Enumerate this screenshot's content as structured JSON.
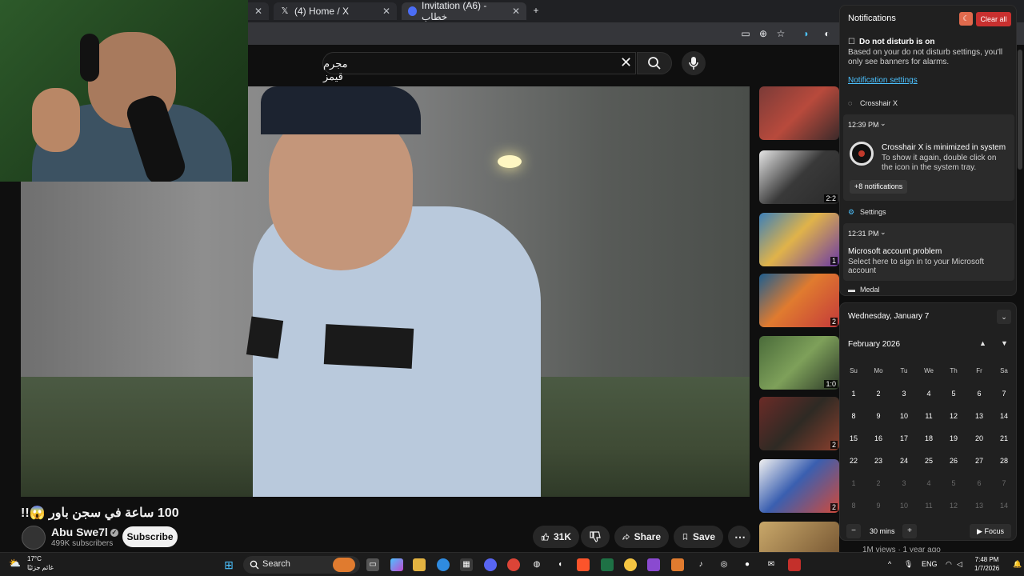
{
  "browser": {
    "tabs": [
      {
        "label": ""
      },
      {
        "label": "(4) Home / X"
      },
      {
        "label": "Invitation (A6) - خطاب"
      }
    ],
    "new_tab": "+"
  },
  "youtube": {
    "search": {
      "value": "مجرم قيمز"
    },
    "video_title": "100 ساعة في سجن باور 😱!!",
    "channel": {
      "name": "Abu Swe7l",
      "subscribers": "499K subscribers"
    },
    "subscribe_label": "Subscribe",
    "actions": {
      "like_count": "31K",
      "share_label": "Share",
      "save_label": "Save"
    },
    "sidebar": [
      {
        "duration": ""
      },
      {
        "duration": "2:2"
      },
      {
        "duration": "1"
      },
      {
        "duration": "2"
      },
      {
        "duration": "1:0"
      },
      {
        "duration": "2"
      },
      {
        "duration": "2"
      },
      {
        "duration": ""
      }
    ],
    "sidebar_meta": [
      {
        "text": "1M views · 1 year ago"
      }
    ]
  },
  "notifications": {
    "header": "Notifications",
    "clear_all": "Clear all",
    "dnd_title": "Do not disturb is on",
    "dnd_body": "Based on your do not disturb settings, you'll only see banners for alarms.",
    "settings_link": "Notification settings",
    "groups": [
      {
        "app": "Crosshair X",
        "time": "12:39 PM",
        "title": "Crosshair X is minimized in system",
        "body": "To show it again, double click on the icon in the system tray.",
        "more": "+8 notifications"
      },
      {
        "app": "Settings",
        "time": "12:31 PM",
        "title": "Microsoft account problem",
        "body": "Select here to sign in to your Microsoft account"
      },
      {
        "app": "Medal"
      }
    ]
  },
  "calendar": {
    "date": "Wednesday, January 7",
    "month": "February 2026",
    "weekdays": [
      "Su",
      "Mo",
      "Tu",
      "We",
      "Th",
      "Fr",
      "Sa"
    ],
    "days": [
      [
        "1",
        "2",
        "3",
        "4",
        "5",
        "6",
        "7"
      ],
      [
        "8",
        "9",
        "10",
        "11",
        "12",
        "13",
        "14"
      ],
      [
        "15",
        "16",
        "17",
        "18",
        "19",
        "20",
        "21"
      ],
      [
        "22",
        "23",
        "24",
        "25",
        "26",
        "27",
        "28"
      ],
      [
        "1",
        "2",
        "3",
        "4",
        "5",
        "6",
        "7"
      ],
      [
        "8",
        "9",
        "10",
        "11",
        "12",
        "13",
        "14"
      ]
    ],
    "focus_minutes": "30 mins",
    "focus_label": "Focus",
    "minus": "−",
    "plus": "+"
  },
  "taskbar": {
    "weather_temp": "17°C",
    "weather_text": "غائم جزئيًا",
    "search_placeholder": "Search",
    "language": "ENG",
    "time": "7:48 PM",
    "date": "1/7/2026"
  },
  "colors": {
    "accent": "#4cc2ff",
    "clear_all": "#c8302f",
    "youtube_bg": "#0f0f0f"
  }
}
